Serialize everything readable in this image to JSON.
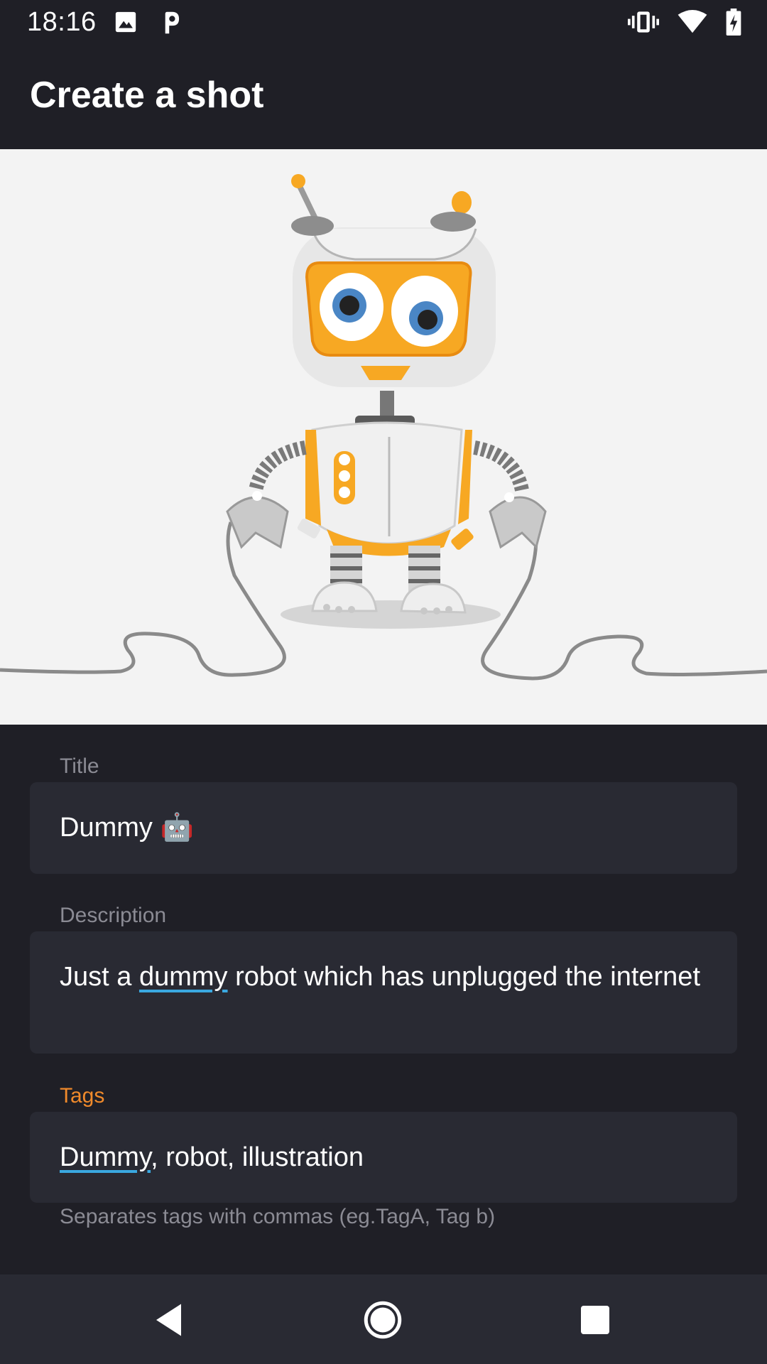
{
  "status_bar": {
    "time": "18:16",
    "left_icons": [
      "image-icon",
      "parking-icon"
    ],
    "right_icons": [
      "vibrate-icon",
      "wifi-icon",
      "battery-charging-icon"
    ]
  },
  "app_bar": {
    "title": "Create a shot"
  },
  "hero": {
    "image": "robot-illustration"
  },
  "form": {
    "title": {
      "label": "Title",
      "value": "Dummy 🤖"
    },
    "description": {
      "label": "Description",
      "value_before": "Just a ",
      "value_underlined": "dummy",
      "value_after": " robot which has unplugged the internet"
    },
    "tags": {
      "label": "Tags",
      "value_underlined": "Dummy",
      "value_after": ", robot, illustration",
      "helper": "Separates tags with commas (eg.TagA, Tag b)"
    }
  },
  "colors": {
    "background": "#1f1f26",
    "field": "#292a33",
    "accent": "#f08a2b",
    "spell_underline": "#3aa8e0"
  },
  "nav_bar": {
    "buttons": [
      "back-icon",
      "home-icon",
      "recents-icon"
    ]
  }
}
